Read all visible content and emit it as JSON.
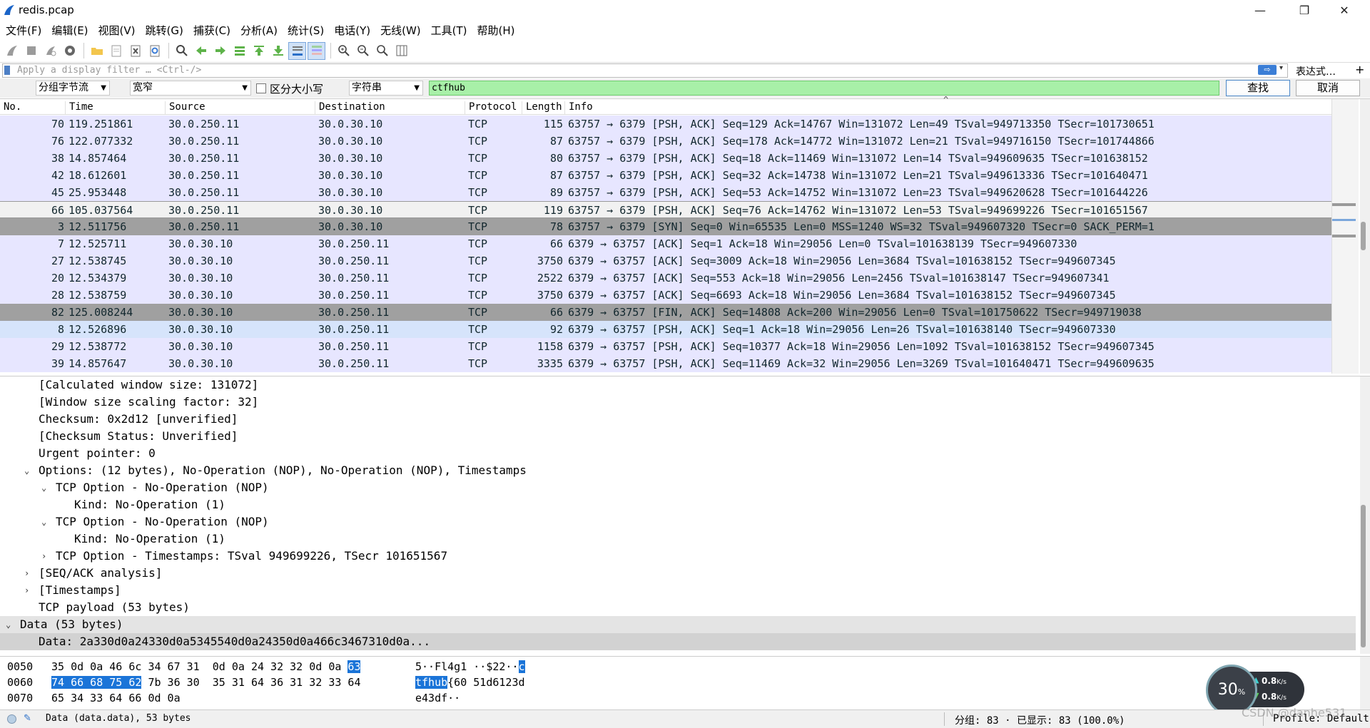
{
  "window": {
    "title": "redis.pcap",
    "controls": {
      "minimize": "—",
      "maximize": "❐",
      "close": "✕"
    }
  },
  "menu": [
    "文件(F)",
    "编辑(E)",
    "视图(V)",
    "跳转(G)",
    "捕获(C)",
    "分析(A)",
    "统计(S)",
    "电话(Y)",
    "无线(W)",
    "工具(T)",
    "帮助(H)"
  ],
  "toolbar_icons": [
    "shark-fin-start-icon",
    "stop-capture-icon",
    "restart-capture-icon",
    "capture-options-icon",
    "open-file-icon",
    "save-file-icon",
    "close-file-icon",
    "reload-icon",
    "find-packet-icon",
    "go-back-icon",
    "go-forward-icon",
    "go-to-packet-icon",
    "first-packet-icon",
    "last-packet-icon",
    "autoscroll-icon",
    "colorize-icon",
    "zoom-in-icon",
    "zoom-out-icon",
    "zoom-reset-icon",
    "resize-columns-icon"
  ],
  "filter": {
    "placeholder": "Apply a display filter … <Ctrl-/>",
    "apply_arrow": "⇨",
    "expression_label": "表达式…",
    "plus": "+"
  },
  "search": {
    "scope": "分组字节流",
    "charset": "宽窄",
    "case_label": "区分大小写",
    "type": "字符串",
    "value": "ctfhub",
    "find_label": "查找",
    "cancel_label": "取消",
    "highlight_color": "#a8f0a8"
  },
  "packet_list": {
    "columns": [
      "No.",
      "Time",
      "Source",
      "Destination",
      "Protocol",
      "Length",
      "Info"
    ],
    "sort_caret": "^",
    "rows": [
      {
        "no": "70",
        "time": "119.251861",
        "src": "30.0.250.11",
        "dst": "30.0.30.10",
        "proto": "TCP",
        "len": "115",
        "info": "63757 → 6379 [PSH, ACK] Seq=129 Ack=14767 Win=131072 Len=49 TSval=949713350 TSecr=101730651",
        "style": "normal"
      },
      {
        "no": "76",
        "time": "122.077332",
        "src": "30.0.250.11",
        "dst": "30.0.30.10",
        "proto": "TCP",
        "len": "87",
        "info": "63757 → 6379 [PSH, ACK] Seq=178 Ack=14772 Win=131072 Len=21 TSval=949716150 TSecr=101744866",
        "style": "normal"
      },
      {
        "no": "38",
        "time": "14.857464",
        "src": "30.0.250.11",
        "dst": "30.0.30.10",
        "proto": "TCP",
        "len": "80",
        "info": "63757 → 6379 [PSH, ACK] Seq=18 Ack=11469 Win=131072 Len=14 TSval=949609635 TSecr=101638152",
        "style": "normal"
      },
      {
        "no": "42",
        "time": "18.612601",
        "src": "30.0.250.11",
        "dst": "30.0.30.10",
        "proto": "TCP",
        "len": "87",
        "info": "63757 → 6379 [PSH, ACK] Seq=32 Ack=14738 Win=131072 Len=21 TSval=949613336 TSecr=101640471",
        "style": "normal"
      },
      {
        "no": "45",
        "time": "25.953448",
        "src": "30.0.250.11",
        "dst": "30.0.30.10",
        "proto": "TCP",
        "len": "89",
        "info": "63757 → 6379 [PSH, ACK] Seq=53 Ack=14752 Win=131072 Len=23 TSval=949620628 TSecr=101644226",
        "style": "normal"
      },
      {
        "no": "66",
        "time": "105.037564",
        "src": "30.0.250.11",
        "dst": "30.0.30.10",
        "proto": "TCP",
        "len": "119",
        "info": "63757 → 6379 [PSH, ACK] Seq=76 Ack=14762 Win=131072 Len=53 TSval=949699226 TSecr=101651567",
        "style": "sel"
      },
      {
        "no": "3",
        "time": "12.511756",
        "src": "30.0.250.11",
        "dst": "30.0.30.10",
        "proto": "TCP",
        "len": "78",
        "info": "63757 → 6379 [SYN] Seq=0 Win=65535 Len=0 MSS=1240 WS=32 TSval=949607320 TSecr=0 SACK_PERM=1",
        "style": "dark"
      },
      {
        "no": "7",
        "time": "12.525711",
        "src": "30.0.30.10",
        "dst": "30.0.250.11",
        "proto": "TCP",
        "len": "66",
        "info": "6379 → 63757 [ACK] Seq=1 Ack=18 Win=29056 Len=0 TSval=101638139 TSecr=949607330",
        "style": "normal"
      },
      {
        "no": "27",
        "time": "12.538745",
        "src": "30.0.30.10",
        "dst": "30.0.250.11",
        "proto": "TCP",
        "len": "3750",
        "info": "6379 → 63757 [ACK] Seq=3009 Ack=18 Win=29056 Len=3684 TSval=101638152 TSecr=949607345",
        "style": "normal"
      },
      {
        "no": "20",
        "time": "12.534379",
        "src": "30.0.30.10",
        "dst": "30.0.250.11",
        "proto": "TCP",
        "len": "2522",
        "info": "6379 → 63757 [ACK] Seq=553 Ack=18 Win=29056 Len=2456 TSval=101638147 TSecr=949607341",
        "style": "normal"
      },
      {
        "no": "28",
        "time": "12.538759",
        "src": "30.0.30.10",
        "dst": "30.0.250.11",
        "proto": "TCP",
        "len": "3750",
        "info": "6379 → 63757 [ACK] Seq=6693 Ack=18 Win=29056 Len=3684 TSval=101638152 TSecr=949607345",
        "style": "normal"
      },
      {
        "no": "82",
        "time": "125.008244",
        "src": "30.0.30.10",
        "dst": "30.0.250.11",
        "proto": "TCP",
        "len": "66",
        "info": "6379 → 63757 [FIN, ACK] Seq=14808 Ack=200 Win=29056 Len=0 TSval=101750622 TSecr=949719038",
        "style": "dark"
      },
      {
        "no": "8",
        "time": "12.526896",
        "src": "30.0.30.10",
        "dst": "30.0.250.11",
        "proto": "TCP",
        "len": "92",
        "info": "6379 → 63757 [PSH, ACK] Seq=1 Ack=18 Win=29056 Len=26 TSval=101638140 TSecr=949607330",
        "style": "blue"
      },
      {
        "no": "29",
        "time": "12.538772",
        "src": "30.0.30.10",
        "dst": "30.0.250.11",
        "proto": "TCP",
        "len": "1158",
        "info": "6379 → 63757 [PSH, ACK] Seq=10377 Ack=18 Win=29056 Len=1092 TSval=101638152 TSecr=949607345",
        "style": "normal"
      },
      {
        "no": "39",
        "time": "14.857647",
        "src": "30.0.30.10",
        "dst": "30.0.250.11",
        "proto": "TCP",
        "len": "3335",
        "info": "6379 → 63757 [PSH, ACK] Seq=11469 Ack=32 Win=29056 Len=3269 TSval=101640471 TSecr=949609635",
        "style": "normal"
      }
    ]
  },
  "ime_badge": "英",
  "details": [
    {
      "text": "[Calculated window size: 131072]",
      "indent": 2,
      "toggle": ""
    },
    {
      "text": "[Window size scaling factor: 32]",
      "indent": 2,
      "toggle": ""
    },
    {
      "text": "Checksum: 0x2d12 [unverified]",
      "indent": 2,
      "toggle": ""
    },
    {
      "text": "[Checksum Status: Unverified]",
      "indent": 2,
      "toggle": ""
    },
    {
      "text": "Urgent pointer: 0",
      "indent": 2,
      "toggle": ""
    },
    {
      "text": "Options: (12 bytes), No-Operation (NOP), No-Operation (NOP), Timestamps",
      "indent": 2,
      "toggle": "⌄"
    },
    {
      "text": "TCP Option - No-Operation (NOP)",
      "indent": 3,
      "toggle": "⌄"
    },
    {
      "text": "Kind: No-Operation (1)",
      "indent": 4,
      "toggle": ""
    },
    {
      "text": "TCP Option - No-Operation (NOP)",
      "indent": 3,
      "toggle": "⌄"
    },
    {
      "text": "Kind: No-Operation (1)",
      "indent": 4,
      "toggle": ""
    },
    {
      "text": "TCP Option - Timestamps: TSval 949699226, TSecr 101651567",
      "indent": 3,
      "toggle": "›"
    },
    {
      "text": "[SEQ/ACK analysis]",
      "indent": 2,
      "toggle": "›"
    },
    {
      "text": "[Timestamps]",
      "indent": 2,
      "toggle": "›"
    },
    {
      "text": "TCP payload (53 bytes)",
      "indent": 2,
      "toggle": ""
    },
    {
      "text": "Data (53 bytes)",
      "indent": 1,
      "toggle": "⌄",
      "style": "highlight"
    },
    {
      "text": "Data: 2a330d0a24330d0a5345540d0a24350d0a466c3467310d0a...",
      "indent": 2,
      "toggle": "",
      "style": "selected"
    }
  ],
  "bytes": [
    {
      "offset": "0050",
      "hex_pre": "35 0d 0a 46 6c 34 67 31  0d 0a 24 32 32 0d 0a ",
      "hex_hl": "63",
      "hex_post": "",
      "ascii_pre": "5··Fl4g1 ··$22··",
      "ascii_hl": "c",
      "ascii_post": ""
    },
    {
      "offset": "0060",
      "hex_pre": "",
      "hex_hl": "74 66 68 75 62",
      "hex_post": " 7b 36 30  35 31 64 36 31 32 33 64",
      "ascii_pre": "",
      "ascii_hl": "tfhub",
      "ascii_post": "{60 51d6123d"
    },
    {
      "offset": "0070",
      "hex_pre": "65 34 33 64 66 0d 0a",
      "hex_hl": "",
      "hex_post": "",
      "ascii_pre": "e43df··",
      "ascii_hl": "",
      "ascii_post": ""
    }
  ],
  "net_widget": {
    "percent": "30",
    "percent_sign": "%",
    "up": "0.8",
    "down": "0.8",
    "unit": "K/s",
    "up_arrow": "▲",
    "down_arrow": "▼"
  },
  "status": {
    "edit_icon": "✎",
    "field_info": "Data (data.data), 53 bytes",
    "packets": "分组: 83 · 已显示: 83 (100.0%)",
    "profile": "Profile: Default"
  },
  "watermark": "CSDN @danhe531"
}
